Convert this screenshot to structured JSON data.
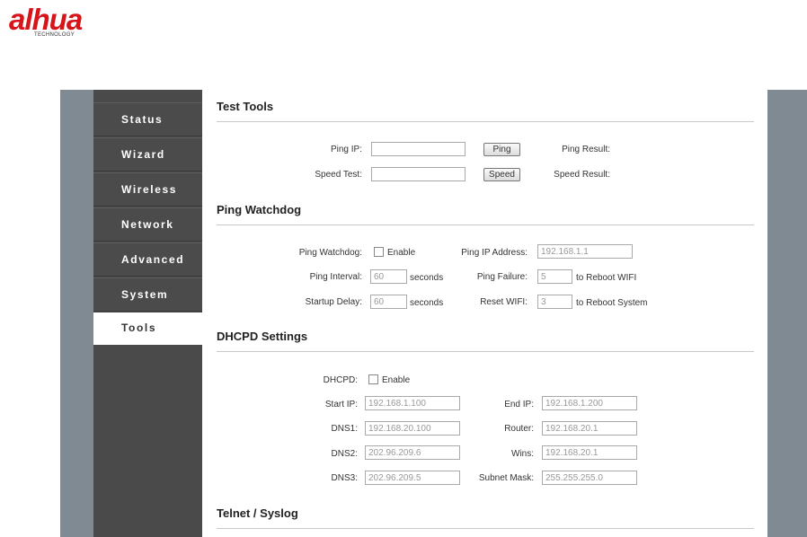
{
  "logo": {
    "brand": "alhua",
    "sub": "TECHNOLOGY"
  },
  "sidebar": {
    "items": [
      {
        "label": "Status"
      },
      {
        "label": "Wizard"
      },
      {
        "label": "Wireless"
      },
      {
        "label": "Network"
      },
      {
        "label": "Advanced"
      },
      {
        "label": "System"
      },
      {
        "label": "Tools",
        "active": true
      }
    ]
  },
  "test_tools": {
    "title": "Test Tools",
    "ping_ip_label": "Ping IP:",
    "ping_ip_value": "",
    "ping_button": "Ping",
    "ping_result_label": "Ping Result:",
    "speed_test_label": "Speed Test:",
    "speed_test_value": "",
    "speed_button": "Speed",
    "speed_result_label": "Speed Result:"
  },
  "ping_watchdog": {
    "title": "Ping Watchdog",
    "watchdog_label": "Ping Watchdog:",
    "enable_label": "Enable",
    "ping_ip_address_label": "Ping IP Address:",
    "ping_ip_address_value": "192.168.1.1",
    "ping_interval_label": "Ping Interval:",
    "ping_interval_value": "60",
    "ping_interval_unit": "seconds",
    "ping_failure_label": "Ping Failure:",
    "ping_failure_value": "5",
    "ping_failure_unit": "to Reboot WIFI",
    "startup_delay_label": "Startup Delay:",
    "startup_delay_value": "60",
    "startup_delay_unit": "seconds",
    "reset_wifi_label": "Reset WIFI:",
    "reset_wifi_value": "3",
    "reset_wifi_unit": "to Reboot System"
  },
  "dhcpd": {
    "title": "DHCPD Settings",
    "dhcpd_label": "DHCPD:",
    "enable_label": "Enable",
    "start_ip_label": "Start IP:",
    "start_ip_value": "192.168.1.100",
    "end_ip_label": "End IP:",
    "end_ip_value": "192.168.1.200",
    "dns1_label": "DNS1:",
    "dns1_value": "192.168.20.100",
    "router_label": "Router:",
    "router_value": "192.168.20.1",
    "dns2_label": "DNS2:",
    "dns2_value": "202.96.209.6",
    "wins_label": "Wins:",
    "wins_value": "192.168.20.1",
    "dns3_label": "DNS3:",
    "dns3_value": "202.96.209.5",
    "subnet_label": "Subnet Mask:",
    "subnet_value": "255.255.255.0"
  },
  "telnet": {
    "title": "Telnet / Syslog"
  }
}
